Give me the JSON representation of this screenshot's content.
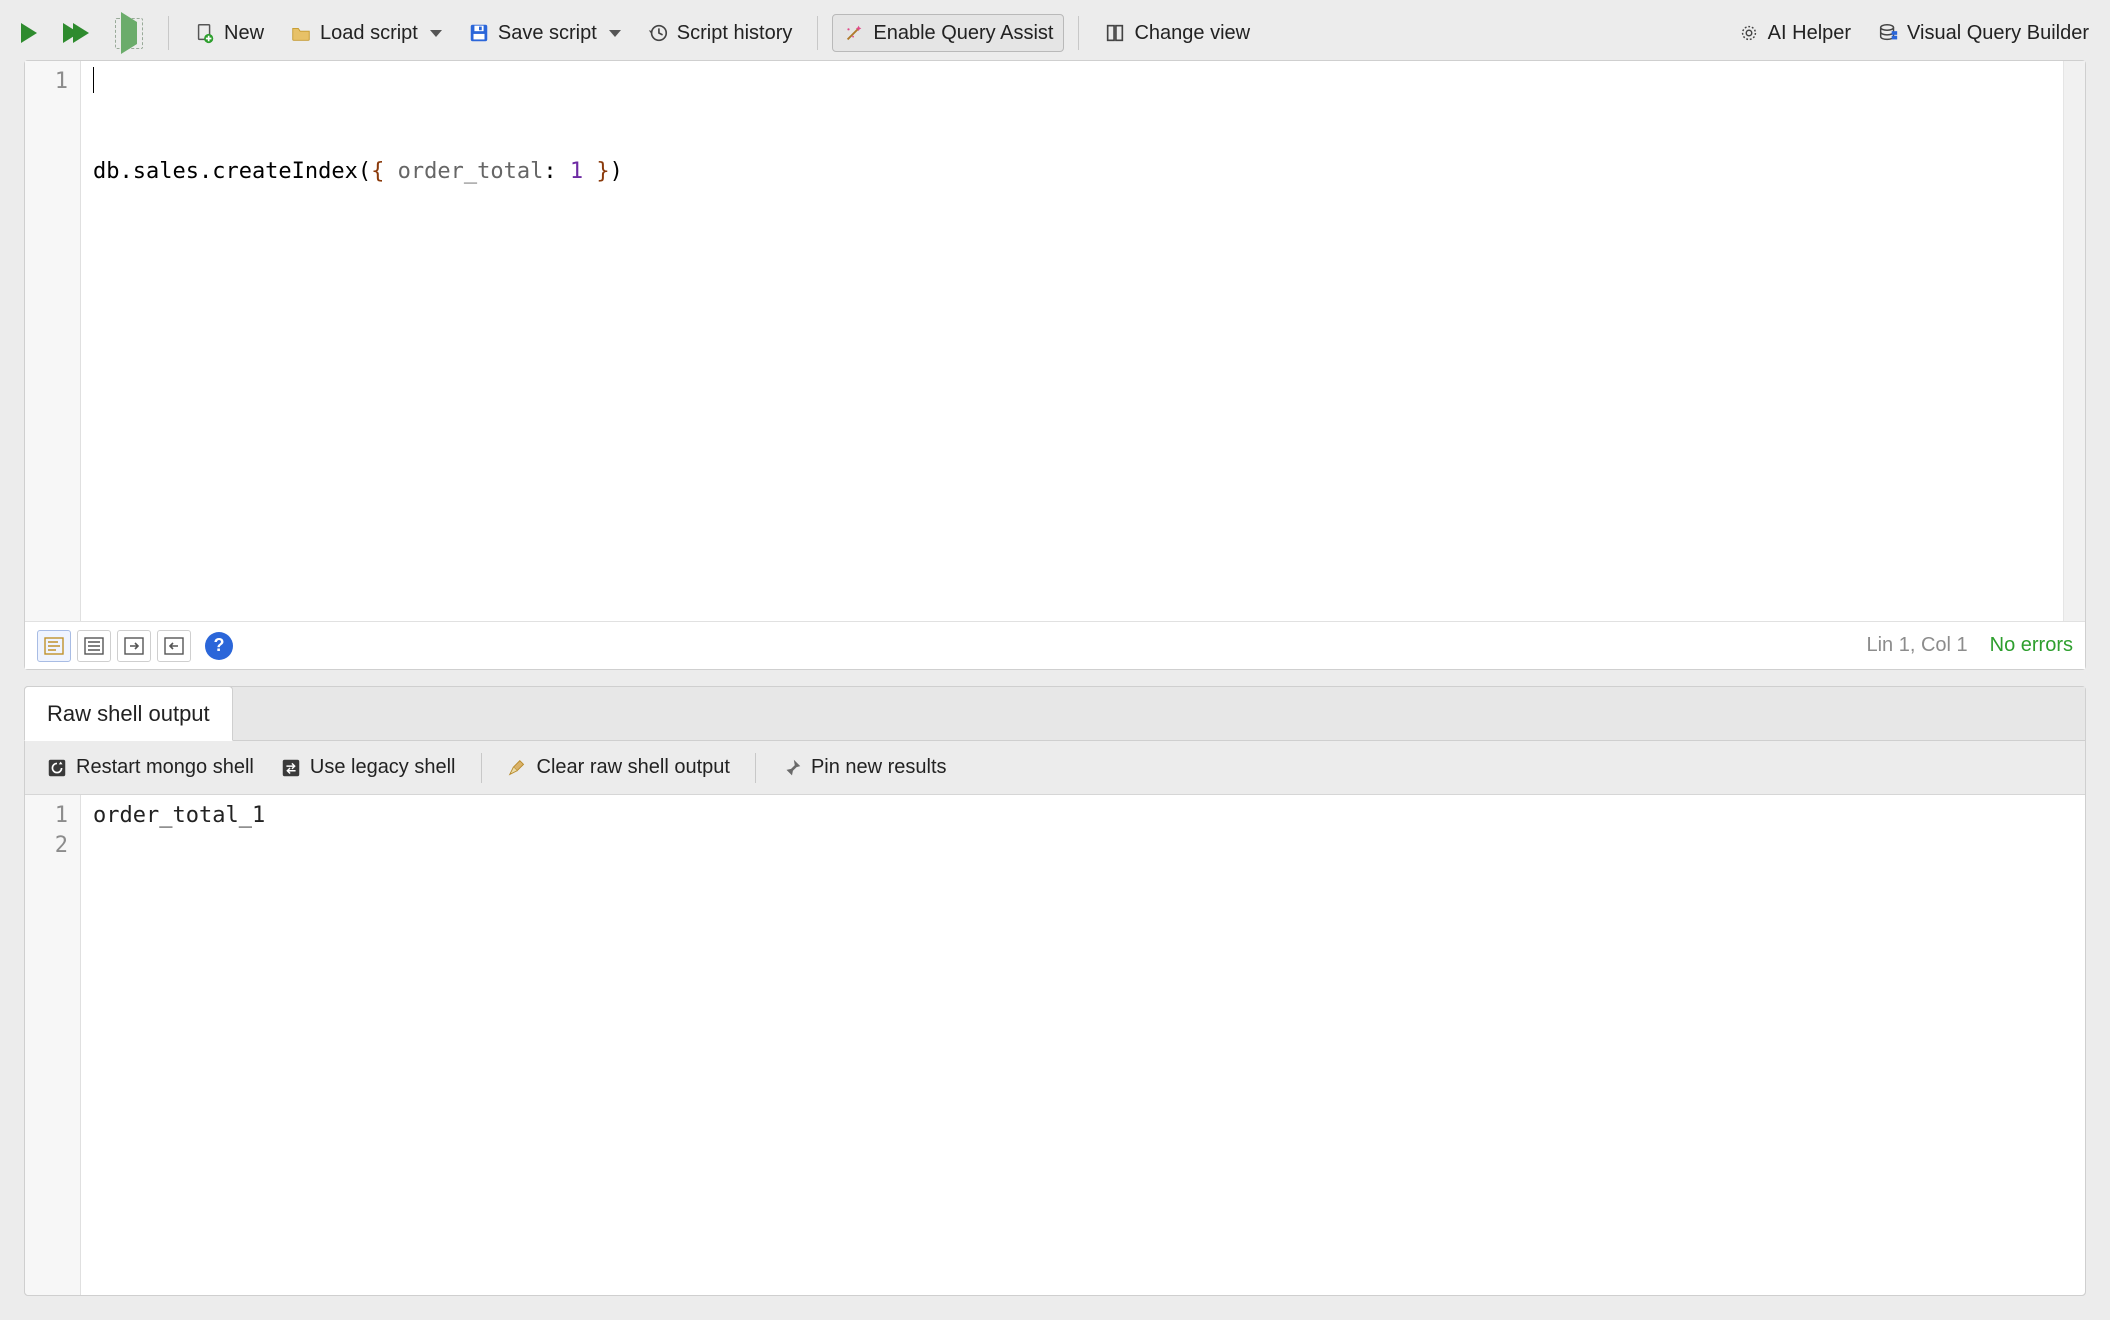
{
  "toolbar": {
    "new_label": "New",
    "load_script_label": "Load script",
    "save_script_label": "Save script",
    "script_history_label": "Script history",
    "enable_query_assist_label": "Enable Query Assist",
    "change_view_label": "Change view",
    "ai_helper_label": "AI Helper",
    "visual_query_builder_label": "Visual Query Builder"
  },
  "editor": {
    "lines": [
      {
        "num": "1",
        "tokens": [
          {
            "t": "db.sales.createIndex(",
            "cls": "tok-str"
          },
          {
            "t": "{ ",
            "cls": "tok-brace"
          },
          {
            "t": "order_total",
            "cls": "tok-prop"
          },
          {
            "t": ": ",
            "cls": "tok-str"
          },
          {
            "t": "1",
            "cls": "tok-num"
          },
          {
            "t": " }",
            "cls": "tok-brace"
          },
          {
            "t": ")",
            "cls": "tok-str"
          }
        ]
      }
    ],
    "status_position": "Lin 1, Col 1",
    "status_errors": "No errors"
  },
  "footer_help": "?",
  "output": {
    "tab_label": "Raw shell output",
    "toolbar": {
      "restart_label": "Restart mongo shell",
      "use_legacy_label": "Use legacy shell",
      "clear_label": "Clear raw shell output",
      "pin_label": "Pin new results"
    },
    "lines": [
      {
        "num": "1",
        "text": "order_total_1"
      },
      {
        "num": "2",
        "text": ""
      }
    ]
  }
}
